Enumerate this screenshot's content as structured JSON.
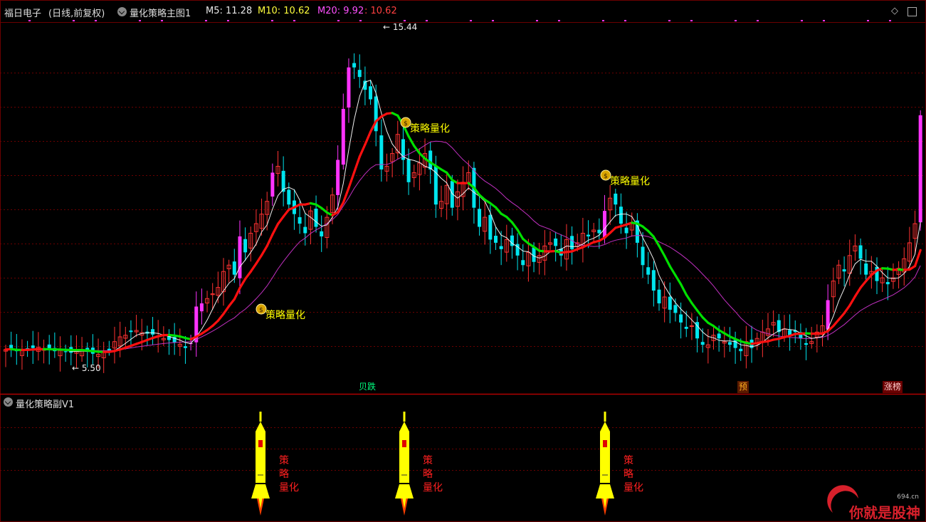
{
  "header": {
    "stock": "福日电子",
    "mode": "(日线,前复权)",
    "indicator": "量化策略主图1",
    "ma5": "M5: 11.28",
    "ma10": "M10: 10.62",
    "ma20": "M20: 9.92",
    "extra": ": 10.62"
  },
  "sub_header": {
    "indicator": "量化策略副V1"
  },
  "labels": {
    "strategy": "策略量化",
    "high": "15.44",
    "low": "5.50",
    "tag_gui": "贝跌",
    "tag_yu": "预",
    "tag_zhang": "涨榜",
    "sub_vertical_1": "策",
    "sub_vertical_2": "略",
    "sub_vertical_3": "量化"
  },
  "watermark": {
    "text": "你就是股神",
    "url": "694.cn"
  },
  "colors": {
    "up": "#ff3232",
    "down": "#00e5ee",
    "magenta": "#ff33ff",
    "ma_red": "#ff1010",
    "ma_green": "#00e000",
    "ma20": "#c030c0",
    "ma5": "#f0f0f0",
    "grid": "#6b0000",
    "yellow": "#ffff00"
  },
  "chart_data": {
    "type": "candlestick",
    "closes": [
      5.65,
      5.68,
      5.6,
      5.62,
      5.66,
      5.7,
      5.72,
      5.68,
      5.64,
      5.6,
      5.62,
      5.58,
      5.55,
      5.6,
      5.65,
      5.58,
      5.52,
      5.5,
      5.56,
      5.62,
      5.9,
      6.05,
      6.1,
      6.2,
      6.25,
      6.18,
      6.15,
      6.12,
      6.08,
      6.0,
      5.95,
      5.88,
      5.82,
      5.7,
      5.85,
      7.0,
      7.1,
      7.25,
      7.4,
      7.6,
      8.1,
      8.3,
      8.0,
      9.2,
      8.7,
      9.3,
      9.6,
      9.9,
      10.3,
      11.2,
      11.4,
      10.6,
      10.2,
      9.9,
      9.6,
      9.3,
      10.0,
      9.5,
      9.2,
      9.8,
      10.5,
      11.6,
      13.2,
      14.5,
      14.5,
      14.2,
      13.8,
      13.5,
      12.5,
      11.3,
      11.4,
      11.8,
      12.4,
      11.6,
      10.9,
      11.2,
      11.5,
      11.8,
      11.3,
      10.2,
      10.3,
      10.8,
      10.1,
      10.6,
      10.9,
      11.2,
      10.1,
      9.5,
      9.8,
      9.1,
      9.0,
      8.8,
      9.1,
      8.9,
      8.6,
      8.3,
      8.7,
      8.4,
      8.6,
      8.9,
      9.0,
      8.9,
      8.6,
      9.1,
      8.8,
      9.0,
      9.3,
      9.2,
      9.4,
      9.3,
      10.0,
      10.4,
      10.2,
      9.6,
      9.3,
      9.6,
      9.0,
      8.3,
      8.0,
      7.5,
      7.1,
      7.3,
      6.9,
      6.8,
      6.5,
      6.3,
      6.4,
      6.0,
      5.8,
      5.8,
      6.1,
      6.0,
      5.9,
      5.8,
      5.7,
      5.6,
      5.9,
      5.7,
      6.0,
      6.2,
      6.3,
      6.5,
      6.2,
      6.3,
      6.1,
      6.2,
      6.0,
      5.8,
      5.9,
      6.2,
      6.4,
      7.2,
      7.8,
      8.3,
      8.1,
      8.6,
      8.9,
      8.5,
      8.0,
      8.1,
      7.8,
      7.9,
      7.7,
      7.9,
      8.2,
      8.5,
      9.0,
      9.6,
      13.0
    ],
    "high_label": 15.44,
    "low_label": 5.5,
    "ma5": 11.28,
    "ma10": 10.62,
    "ma20": 9.92
  }
}
